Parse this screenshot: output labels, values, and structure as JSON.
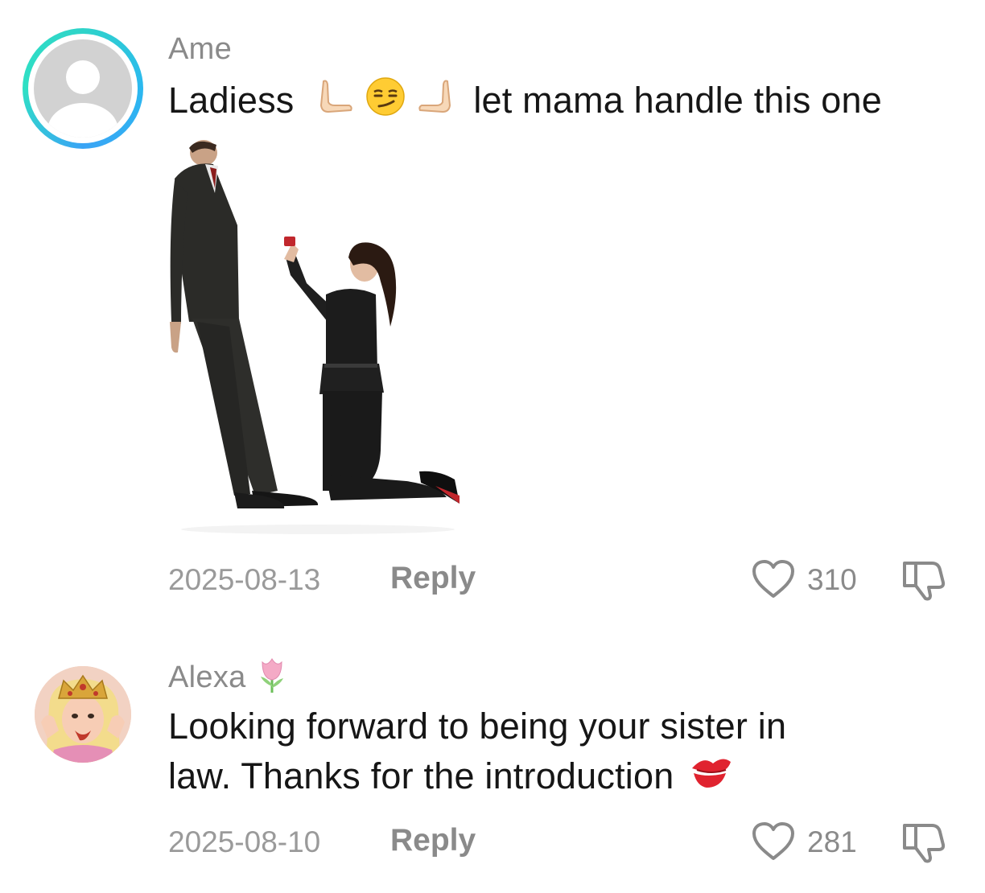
{
  "comments": [
    {
      "username": "Ame",
      "text_before": "Ladiess",
      "text_after": "let mama handle this one",
      "emoji_icons": [
        "raised-hand-left-icon",
        "smirking-face-icon",
        "raised-hand-right-icon"
      ],
      "date": "2025-08-13",
      "reply_label": "Reply",
      "likes": "310",
      "has_image": true
    },
    {
      "username": "Alexa",
      "username_emoji": "tulip-icon",
      "text_line1": "Looking forward to being your sister in",
      "text_line2": "law. Thanks for the introduction",
      "text_emoji": "kiss-mark-icon",
      "date": "2025-08-10",
      "reply_label": "Reply",
      "likes": "281"
    }
  ],
  "colors": {
    "ring_gradient_a": "#2fd4c9",
    "ring_gradient_b": "#2bb8f0",
    "meta_gray": "#8a8a8a",
    "text_dark": "#161616"
  }
}
